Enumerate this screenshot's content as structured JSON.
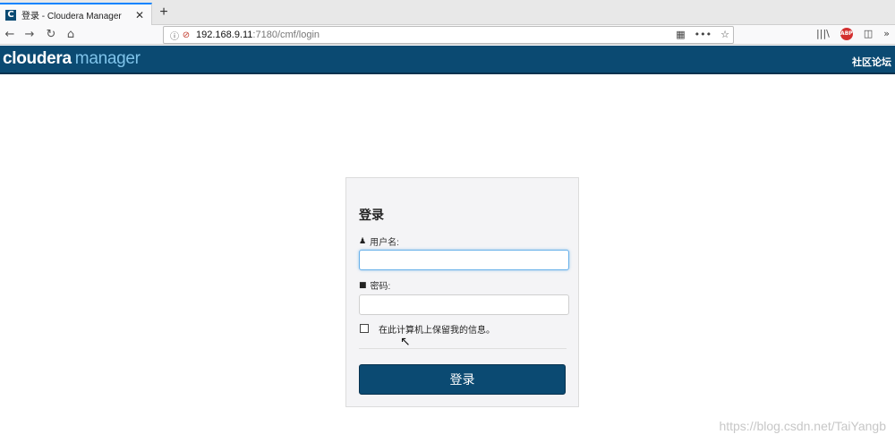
{
  "browser": {
    "tab": {
      "favicon_letter": "C",
      "title": "登录 - Cloudera Manager",
      "close": "✕"
    },
    "newtab": "+",
    "nav": {
      "back": "←",
      "forward": "→",
      "reload": "↻",
      "home": "⌂"
    },
    "url": {
      "info": "ⓘ",
      "lock": "⊘",
      "host": "192.168.9.11",
      "path": ":7180/cmf/login"
    },
    "url_actions": {
      "qr": "▦",
      "more": "•••",
      "star": "☆"
    },
    "toolbar": {
      "library": "|||\\",
      "abp": "ABP",
      "sidebar": "◫",
      "overflow": "»"
    }
  },
  "header": {
    "logo_part1": "cloudera",
    "logo_part2": "manager",
    "community_link": "社区论坛",
    "bg_color": "#0b4a72"
  },
  "login": {
    "title": "登录",
    "username_label": "用户名:",
    "username_icon": "👤",
    "username_value": "",
    "password_label": "密码:",
    "password_icon": "🔒",
    "password_value": "",
    "remember_label": "在此计算机上保留我的信息。",
    "remember_checked": false,
    "submit_label": "登录"
  },
  "overlay": {
    "cursor": "↖",
    "watermark": "https://blog.csdn.net/TaiYangb"
  }
}
